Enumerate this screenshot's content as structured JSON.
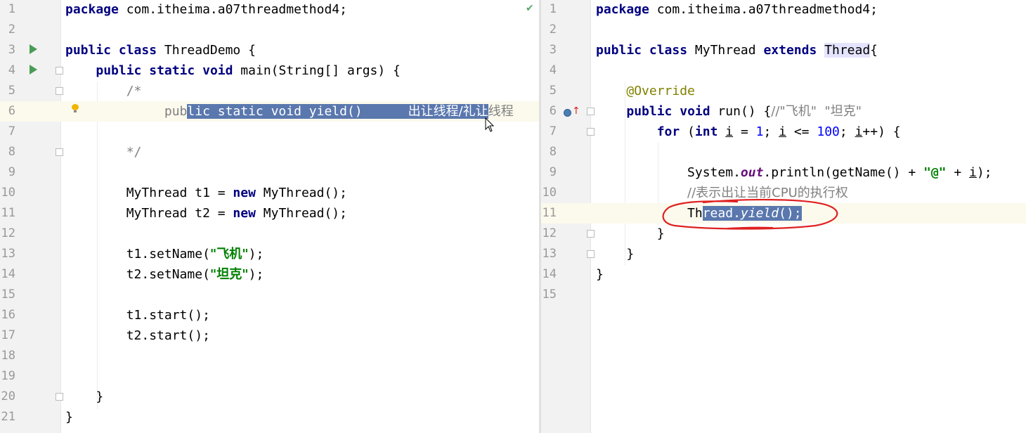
{
  "left": {
    "lines": [
      {
        "n": "1",
        "parts": [
          {
            "t": "package",
            "c": "kw"
          },
          {
            "t": " com.itheima.a07threadmethod4;"
          }
        ]
      },
      {
        "n": "2",
        "parts": []
      },
      {
        "n": "3",
        "parts": [
          {
            "t": "public",
            "c": "kw"
          },
          {
            "t": " "
          },
          {
            "t": "class",
            "c": "kw"
          },
          {
            "t": " ThreadDemo {"
          }
        ]
      },
      {
        "n": "4",
        "parts": [
          {
            "t": "    "
          },
          {
            "t": "public",
            "c": "kw"
          },
          {
            "t": " "
          },
          {
            "t": "static",
            "c": "kw"
          },
          {
            "t": " "
          },
          {
            "t": "void",
            "c": "kw"
          },
          {
            "t": " main(String[] args) {"
          }
        ]
      },
      {
        "n": "5",
        "parts": [
          {
            "t": "        "
          },
          {
            "t": "/*",
            "c": "cm"
          }
        ]
      },
      {
        "n": "6",
        "parts": [
          {
            "t": "             pub",
            "c": "cm"
          },
          {
            "t": "lic static void yield()      ",
            "c": "sel"
          },
          {
            "t": "出让线程/礼让",
            "c": "sel cjk"
          },
          {
            "t": "线程",
            "c": "cm cjk"
          }
        ]
      },
      {
        "n": "7",
        "parts": []
      },
      {
        "n": "8",
        "parts": [
          {
            "t": "        "
          },
          {
            "t": "*/",
            "c": "cm"
          }
        ]
      },
      {
        "n": "9",
        "parts": []
      },
      {
        "n": "10",
        "parts": [
          {
            "t": "        MyThread t1 = "
          },
          {
            "t": "new",
            "c": "kw"
          },
          {
            "t": " MyThread();"
          }
        ]
      },
      {
        "n": "11",
        "parts": [
          {
            "t": "        MyThread t2 = "
          },
          {
            "t": "new",
            "c": "kw"
          },
          {
            "t": " MyThread();"
          }
        ]
      },
      {
        "n": "12",
        "parts": []
      },
      {
        "n": "13",
        "parts": [
          {
            "t": "        t1.setName("
          },
          {
            "t": "\"飞机\"",
            "c": "str cjk"
          },
          {
            "t": ");"
          }
        ]
      },
      {
        "n": "14",
        "parts": [
          {
            "t": "        t2.setName("
          },
          {
            "t": "\"坦克\"",
            "c": "str cjk"
          },
          {
            "t": ");"
          }
        ]
      },
      {
        "n": "15",
        "parts": []
      },
      {
        "n": "16",
        "parts": [
          {
            "t": "        t1.start();"
          }
        ]
      },
      {
        "n": "17",
        "parts": [
          {
            "t": "        t2.start();"
          }
        ]
      },
      {
        "n": "18",
        "parts": []
      },
      {
        "n": "19",
        "parts": []
      },
      {
        "n": "20",
        "parts": [
          {
            "t": "    }"
          }
        ]
      },
      {
        "n": "21",
        "parts": [
          {
            "t": "}"
          }
        ]
      }
    ]
  },
  "right": {
    "lines": [
      {
        "n": "1",
        "parts": [
          {
            "t": "package",
            "c": "kw"
          },
          {
            "t": " com.itheima.a07threadmethod4;"
          }
        ]
      },
      {
        "n": "2",
        "parts": []
      },
      {
        "n": "3",
        "parts": [
          {
            "t": "public",
            "c": "kw"
          },
          {
            "t": " "
          },
          {
            "t": "class",
            "c": "kw"
          },
          {
            "t": " MyThread "
          },
          {
            "t": "extends",
            "c": "kw"
          },
          {
            "t": " "
          },
          {
            "t": "Thread",
            "c": "cls-hl"
          },
          {
            "t": "{"
          }
        ]
      },
      {
        "n": "4",
        "parts": []
      },
      {
        "n": "5",
        "parts": [
          {
            "t": "    "
          },
          {
            "t": "@Override",
            "c": "anno"
          }
        ]
      },
      {
        "n": "6",
        "parts": [
          {
            "t": "    "
          },
          {
            "t": "public",
            "c": "kw"
          },
          {
            "t": " "
          },
          {
            "t": "void",
            "c": "kw"
          },
          {
            "t": " run() {"
          },
          {
            "t": "//\"飞机\"  \"坦克\"",
            "c": "cm cjk"
          }
        ]
      },
      {
        "n": "7",
        "parts": [
          {
            "t": "        "
          },
          {
            "t": "for",
            "c": "kw"
          },
          {
            "t": " ("
          },
          {
            "t": "int",
            "c": "kw"
          },
          {
            "t": " "
          },
          {
            "t": "i",
            "c": "ul"
          },
          {
            "t": " = "
          },
          {
            "t": "1",
            "c": "num"
          },
          {
            "t": "; "
          },
          {
            "t": "i",
            "c": "ul"
          },
          {
            "t": " <= "
          },
          {
            "t": "100",
            "c": "num"
          },
          {
            "t": "; "
          },
          {
            "t": "i",
            "c": "ul"
          },
          {
            "t": "++) {"
          }
        ]
      },
      {
        "n": "8",
        "parts": []
      },
      {
        "n": "9",
        "parts": [
          {
            "t": "            System."
          },
          {
            "t": "out",
            "c": "field"
          },
          {
            "t": ".println(getName() + "
          },
          {
            "t": "\"@\"",
            "c": "str"
          },
          {
            "t": " + "
          },
          {
            "t": "i",
            "c": "ul"
          },
          {
            "t": ");"
          }
        ]
      },
      {
        "n": "10",
        "parts": [
          {
            "t": "            "
          },
          {
            "t": "//表示出让当前CPU的执行权",
            "c": "cm cjk"
          }
        ]
      },
      {
        "n": "11",
        "parts": [
          {
            "t": "            Th"
          },
          {
            "t": "read.",
            "c": "sel"
          },
          {
            "t": "yield",
            "c": "sel italic"
          },
          {
            "t": "();",
            "c": "sel"
          }
        ]
      },
      {
        "n": "12",
        "parts": [
          {
            "t": "        }"
          }
        ]
      },
      {
        "n": "13",
        "parts": [
          {
            "t": "    }"
          }
        ]
      },
      {
        "n": "14",
        "parts": [
          {
            "t": "}"
          }
        ]
      },
      {
        "n": "15",
        "parts": []
      }
    ]
  },
  "icons": {
    "run": "run-icon",
    "fold": "fold-icon",
    "bulb": "bulb-icon",
    "check": "check-icon",
    "override": "override-icon",
    "cursor": "mouse-cursor-icon"
  },
  "glyphs": {
    "check": "✔",
    "override_arrow": "↑"
  }
}
